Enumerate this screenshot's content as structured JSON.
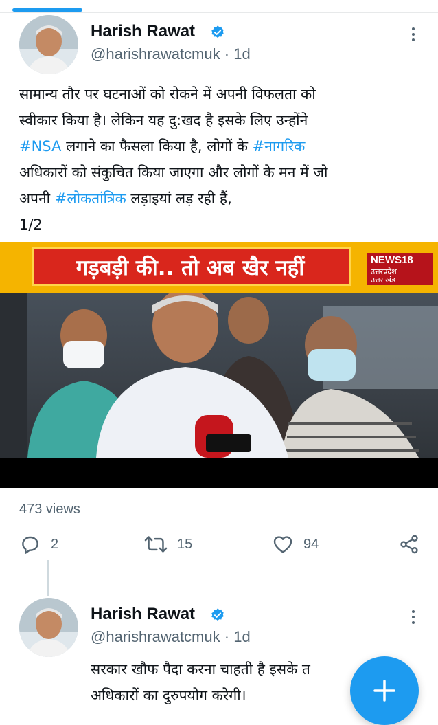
{
  "tweet": {
    "author_name": "Harish Rawat",
    "handle": "@harishrawatcmuk",
    "time": "1d",
    "text_lines": [
      "सामान्य तौर पर घटनाओं को रोकने में अपनी विफलता को",
      "स्वीकार किया है। लेकिन यह दु:खद है इसके लिए उन्होंने",
      {
        "link": "#NSA",
        "rest": " लगाने का फैसला किया है, लोगों के "
      },
      "अधिकारों को संकुचित किया जाएगा और लोगों के मन में जो",
      "अपनी ",
      "1/2"
    ],
    "line3_hashtag2": "#नागरिक",
    "line5_hashtag": "#लोकतांत्रिक",
    "line5_rest": " लड़ाइयां लड़ रही हैं,",
    "media": {
      "banner_text": "गड़बड़ी की.. तो अब खैर नहीं",
      "logo_text": "NEWS18",
      "logo_sub1": "उत्तरप्रदेश",
      "logo_sub2": "उत्तराखंड"
    },
    "views": "473 views",
    "replies": "2",
    "retweets": "15",
    "likes": "94"
  },
  "reply_tweet": {
    "author_name": "Harish Rawat",
    "handle": "@harishrawatcmuk",
    "time": "1d",
    "text_line1": "सरकार खौफ पैदा करना चाहती है इसके त",
    "text_line2": "अधिकारों का दुरुपयोग करेगी।"
  },
  "colors": {
    "accent": "#1d9bf0",
    "secondary_text": "#536471",
    "banner_red": "#d9261c",
    "banner_yellow": "#f5b400"
  },
  "icons": [
    "verified-badge-icon",
    "more-options-icon",
    "reply-icon",
    "retweet-icon",
    "like-icon",
    "share-icon",
    "compose-plus-icon"
  ]
}
